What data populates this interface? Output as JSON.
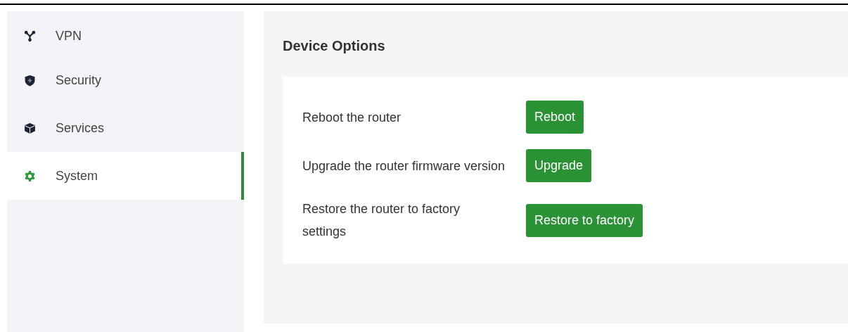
{
  "sidebar": {
    "items": [
      {
        "label": "VPN",
        "selected": false
      },
      {
        "label": "Security",
        "selected": false
      },
      {
        "label": "Services",
        "selected": false
      },
      {
        "label": "System",
        "selected": true
      }
    ]
  },
  "panel": {
    "title": "Device Options",
    "rows": [
      {
        "label": "Reboot the router",
        "button": "Reboot"
      },
      {
        "label": "Upgrade the router firmware version",
        "button": "Upgrade"
      },
      {
        "label": "Restore the router to factory settings",
        "button": "Restore to factory"
      }
    ]
  }
}
